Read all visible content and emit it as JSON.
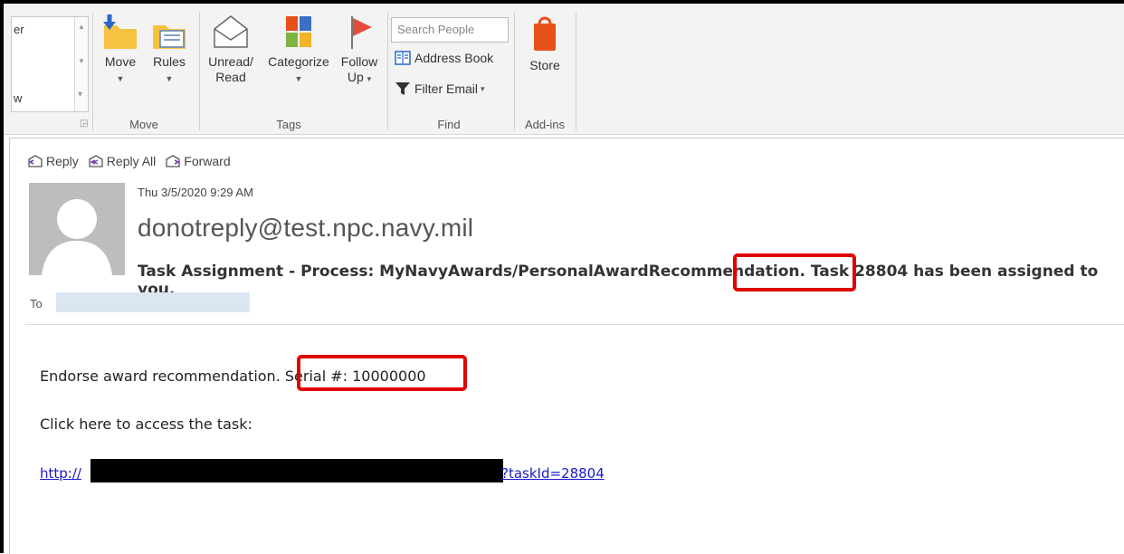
{
  "ribbon": {
    "fragment": {
      "top_text": "er",
      "bottom_text": "w"
    },
    "move_group": {
      "label": "Move",
      "move_label": "Move",
      "rules_label": "Rules"
    },
    "tags_group": {
      "label": "Tags",
      "unread_line1": "Unread/",
      "unread_line2": "Read",
      "categorize_label": "Categorize",
      "follow_line1": "Follow",
      "follow_line2": "Up"
    },
    "find_group": {
      "label": "Find",
      "search_placeholder": "Search People",
      "address_book_label": "Address Book",
      "filter_email_label": "Filter Email"
    },
    "addins_group": {
      "label": "Add-ins",
      "store_label": "Store"
    }
  },
  "message": {
    "actions": {
      "reply": "Reply",
      "reply_all": "Reply All",
      "forward": "Forward"
    },
    "date": "Thu 3/5/2020 9:29 AM",
    "sender": "donotreply@test.npc.navy.mil",
    "subject": "Task Assignment - Process: MyNavyAwards/PersonalAwardRecommendation. Task 28804 has been assigned to you.",
    "to_label": "To",
    "body": {
      "line1": "Endorse award recommendation. Serial #: 10000000",
      "line2": "Click here to access the task:",
      "link_start": "http://",
      "link_end": "?taskId=28804"
    }
  },
  "colors": {
    "highlight": "#e00000",
    "link": "#1a1acc",
    "store_orange": "#e8501a",
    "follow_red": "#e24e3b"
  }
}
